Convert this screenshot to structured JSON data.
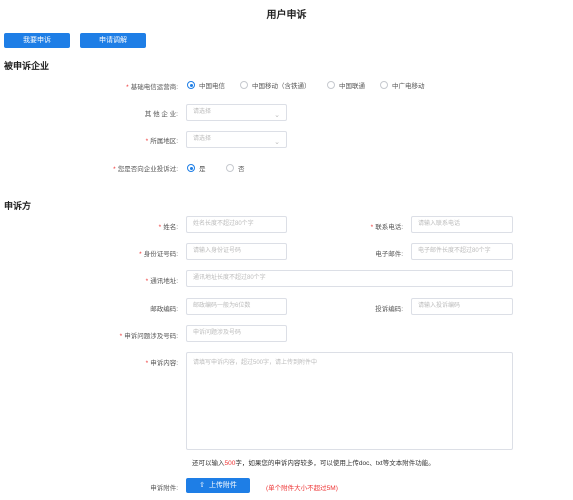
{
  "page": {
    "title": "用户申诉"
  },
  "actions": {
    "complaint_button": "我要申诉",
    "mediation_button": "申请调解"
  },
  "company_section": {
    "heading": "被申诉企业",
    "operator_label": "基础电信运营商:",
    "operators": [
      {
        "label": "中国电信",
        "selected": true
      },
      {
        "label": "中国移动（含铁通）",
        "selected": false
      },
      {
        "label": "中国联通",
        "selected": false
      },
      {
        "label": "中广电移动",
        "selected": false
      }
    ],
    "other_label": "其  他  企  业:",
    "other_placeholder": "请选择",
    "region_label": "所属地区:",
    "region_placeholder": "请选择",
    "complained_label": "您是否向企业投诉过:",
    "complained_options": [
      {
        "label": "是",
        "selected": true
      },
      {
        "label": "否",
        "selected": false
      }
    ]
  },
  "complainant_section": {
    "heading": "申诉方",
    "name_label": "姓名:",
    "name_placeholder": "姓名长度不超过80个字",
    "phone_label": "联系电话:",
    "phone_placeholder": "请输入联系电话",
    "id_label": "身份证号码:",
    "id_placeholder": "请输入身份证号码",
    "email_label": "电子邮件:",
    "email_placeholder": "电子邮件长度不超过80个字",
    "address_label": "通讯地址:",
    "address_placeholder": "通讯地址长度不超过80个字",
    "postcode_label": "邮政编码:",
    "postcode_placeholder": "邮政编码一般为6位数",
    "complaint_code_label": "投诉编码:",
    "complaint_code_placeholder": "请输入投诉编码",
    "number_label": "申诉问题涉及号码:",
    "number_placeholder": "申诉问题涉及号码",
    "content_label": "申诉内容:",
    "content_placeholder": "请填写申诉内容，超过500字，请上传到附件中",
    "hint_prefix": "还可以输入",
    "hint_count": "500",
    "hint_suffix": "字，如果您的申诉内容较多，可以使用上传doc、txt等文本附件功能。",
    "attachment_label": "申诉附件:",
    "upload_button": "上传附件",
    "upload_note": "(单个附件大小不超过5M)"
  }
}
